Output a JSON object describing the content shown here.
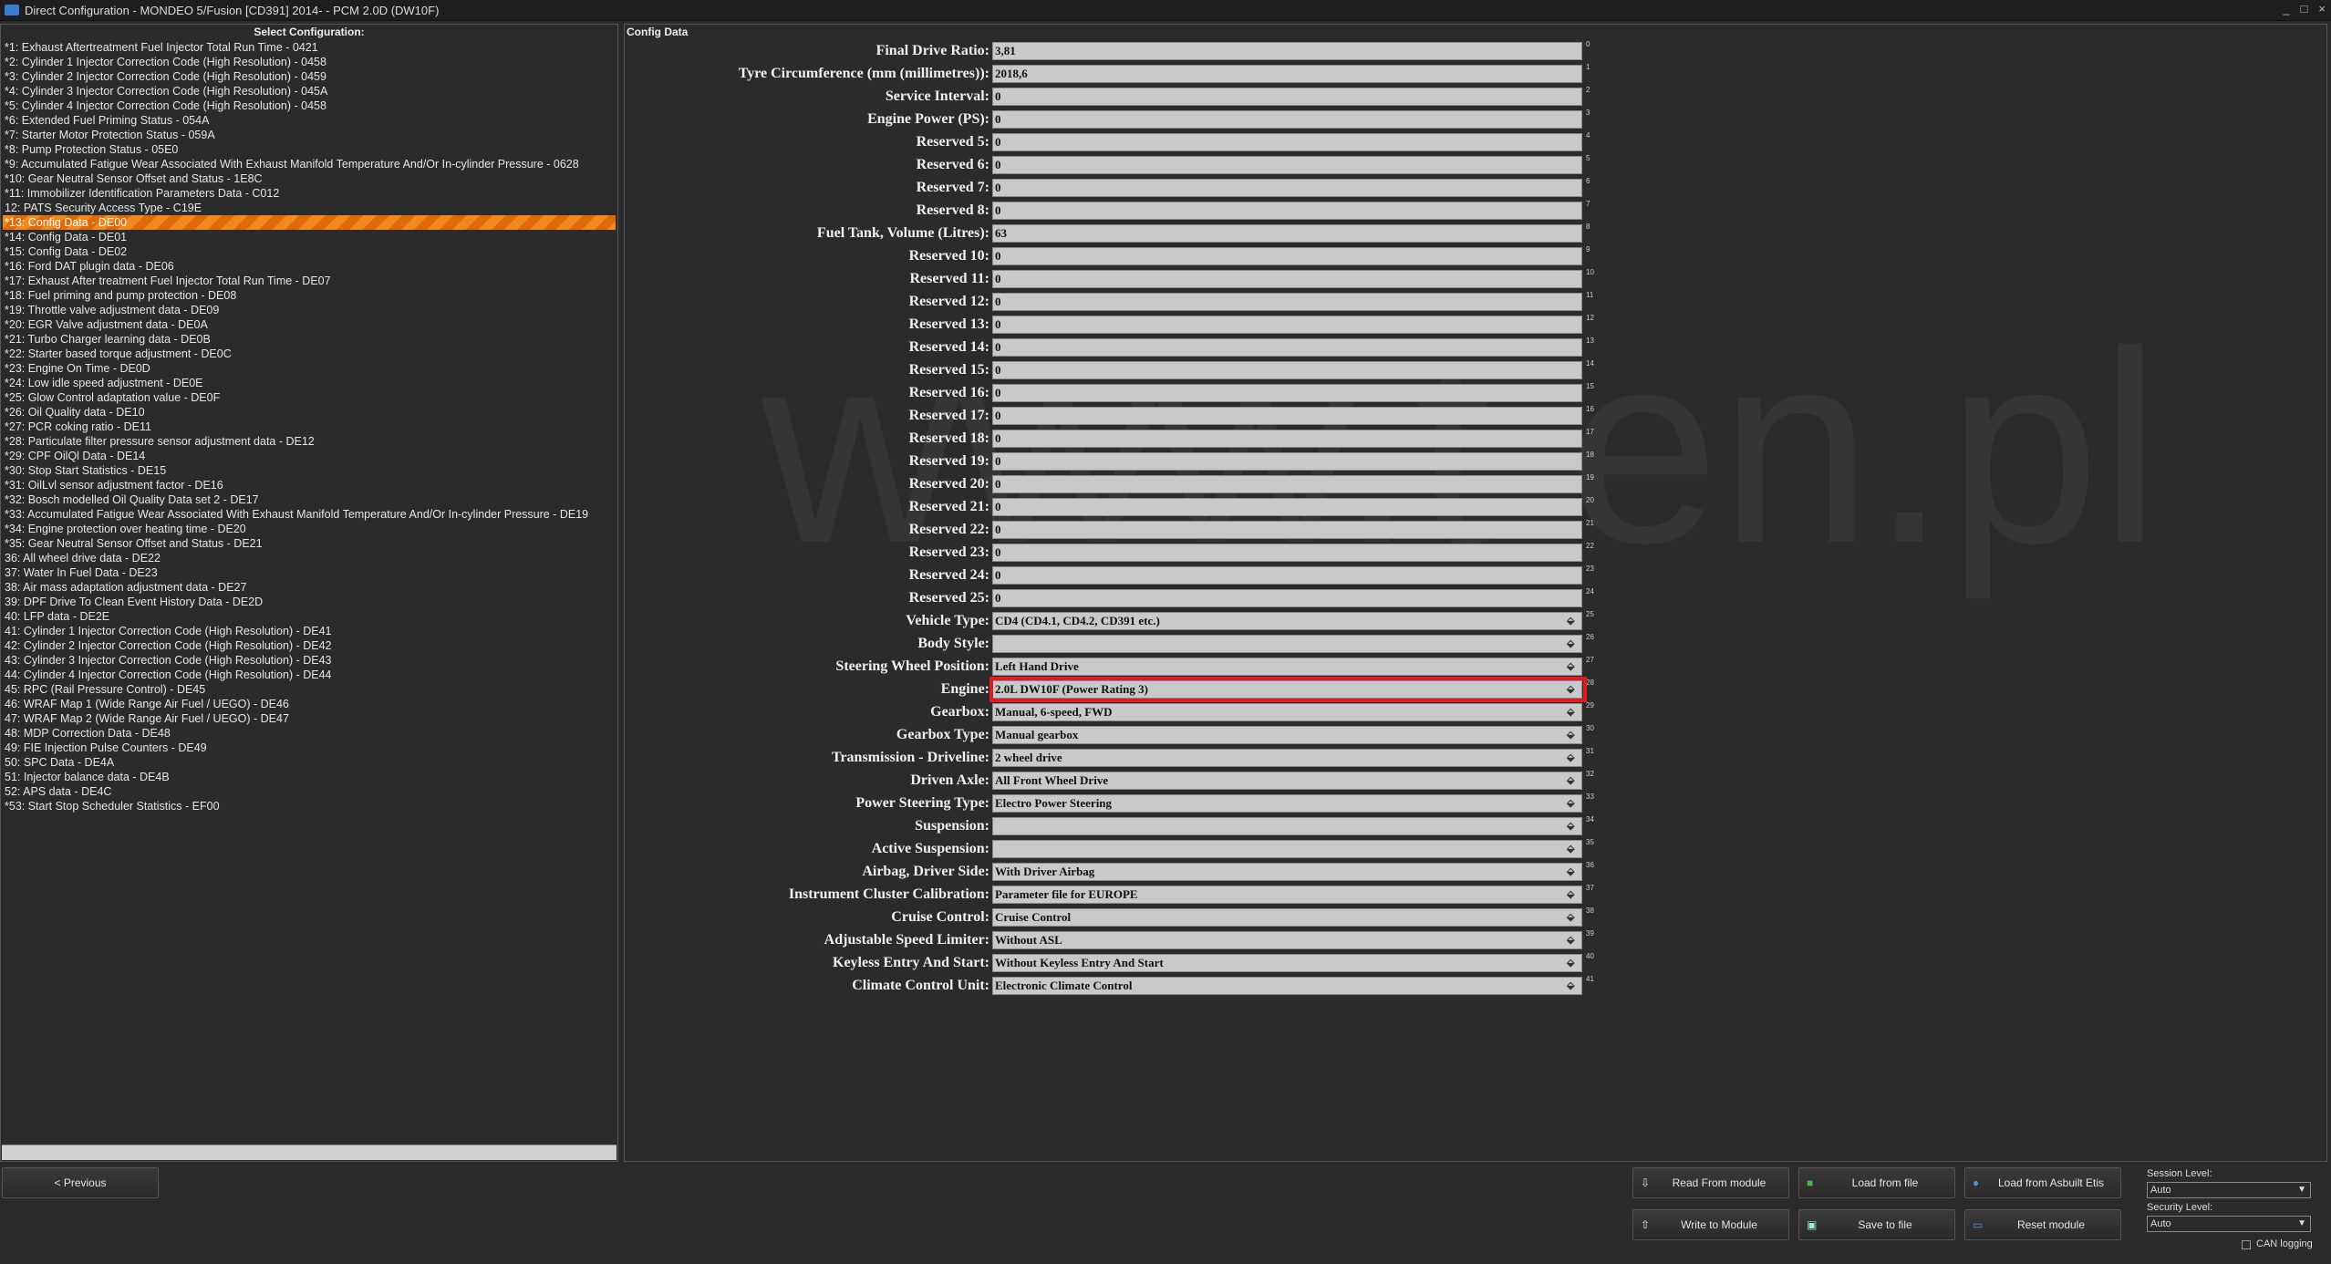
{
  "window": {
    "title": "Direct Configuration - MONDEO 5/Fusion [CD391] 2014- - PCM 2.0D (DW10F)",
    "controls": [
      "_",
      "□",
      "×"
    ]
  },
  "left_panel": {
    "header": "Select Configuration:",
    "items": [
      "*1: Exhaust Aftertreatment Fuel Injector Total Run Time - 0421",
      "*2: Cylinder 1  Injector Correction Code (High Resolution) - 0458",
      "*3: Cylinder 2  Injector Correction Code (High Resolution) - 0459",
      "*4: Cylinder 3  Injector Correction Code (High Resolution) - 045A",
      "*5: Cylinder 4  Injector Correction Code (High Resolution) - 0458",
      "*6: Extended Fuel Priming Status - 054A",
      "*7: Starter Motor Protection Status - 059A",
      "*8: Pump Protection Status - 05E0",
      "*9: Accumulated Fatigue Wear Associated With Exhaust Manifold Temperature And/Or In-cylinder Pressure - 0628",
      "*10: Gear Neutral Sensor Offset and Status - 1E8C",
      "*11: Immobilizer Identification Parameters Data - C012",
      "12: PATS Security Access Type - C19E",
      "*13: Config Data - DE00",
      "*14: Config Data - DE01",
      "*15: Config Data - DE02",
      "*16: Ford DAT plugin data - DE06",
      "*17: Exhaust After treatment Fuel Injector Total Run Time - DE07",
      "*18: Fuel priming and pump protection - DE08",
      "*19: Throttle valve adjustment data - DE09",
      "*20: EGR Valve adjustment  data - DE0A",
      "*21: Turbo Charger learning data - DE0B",
      "*22: Starter based torque adjustment - DE0C",
      "*23: Engine On Time - DE0D",
      "*24: Low idle speed adjustment - DE0E",
      "*25: Glow Control adaptation value - DE0F",
      "*26: Oil Quality  data - DE10",
      "*27: PCR coking ratio - DE11",
      "*28: Particulate filter pressure sensor adjustment data - DE12",
      "*29: CPF OilQl Data - DE14",
      "*30: Stop Start Statistics - DE15",
      "*31: OilLvl sensor adjustment factor - DE16",
      "*32: Bosch modelled Oil Quality Data set 2 - DE17",
      "*33: Accumulated Fatigue Wear Associated With Exhaust Manifold Temperature And/Or In-cylinder Pressure - DE19",
      "*34: Engine protection over heating time - DE20",
      "*35: Gear Neutral Sensor Offset and Status - DE21",
      "36: All wheel drive data - DE22",
      "37: Water In Fuel Data - DE23",
      "38: Air mass adaptation adjustment data - DE27",
      "39: DPF Drive To Clean Event History Data - DE2D",
      "40: LFP data - DE2E",
      "41: Cylinder 1  Injector Correction Code (High Resolution) - DE41",
      "42: Cylinder 2  Injector Correction Code (High Resolution) - DE42",
      "43: Cylinder 3  Injector Correction Code (High Resolution) - DE43",
      "44: Cylinder 4  Injector Correction Code (High Resolution) - DE44",
      "45: RPC (Rail Pressure Control) - DE45",
      "46: WRAF Map 1 (Wide Range Air Fuel / UEGO) - DE46",
      "47: WRAF Map 2 (Wide Range Air Fuel / UEGO) - DE47",
      "48: MDP Correction Data - DE48",
      "49: FIE Injection Pulse Counters - DE49",
      "50: SPC Data - DE4A",
      "51: Injector balance data - DE4B",
      "52: APS data - DE4C",
      "*53: Start Stop Scheduler Statistics - EF00"
    ],
    "selected_index": 12
  },
  "right_panel": {
    "header": "Config Data",
    "watermark": "www.t            en.pl",
    "fields": [
      {
        "label": "Final Drive Ratio:",
        "value": "3,81",
        "index": "0",
        "dropdown": false
      },
      {
        "label": "Tyre Circumference (mm (millimetres)):",
        "value": "2018,6",
        "index": "1",
        "dropdown": false
      },
      {
        "label": "Service Interval:",
        "value": "0",
        "index": "2",
        "dropdown": false
      },
      {
        "label": "Engine Power (PS):",
        "value": "0",
        "index": "3",
        "dropdown": false
      },
      {
        "label": "Reserved 5:",
        "value": "0",
        "index": "4",
        "dropdown": false
      },
      {
        "label": "Reserved 6:",
        "value": "0",
        "index": "5",
        "dropdown": false
      },
      {
        "label": "Reserved 7:",
        "value": "0",
        "index": "6",
        "dropdown": false
      },
      {
        "label": "Reserved 8:",
        "value": "0",
        "index": "7",
        "dropdown": false
      },
      {
        "label": "Fuel Tank, Volume (Litres):",
        "value": "63",
        "index": "8",
        "dropdown": false
      },
      {
        "label": "Reserved 10:",
        "value": "0",
        "index": "9",
        "dropdown": false
      },
      {
        "label": "Reserved 11:",
        "value": "0",
        "index": "10",
        "dropdown": false
      },
      {
        "label": "Reserved 12:",
        "value": "0",
        "index": "11",
        "dropdown": false
      },
      {
        "label": "Reserved 13:",
        "value": "0",
        "index": "12",
        "dropdown": false
      },
      {
        "label": "Reserved 14:",
        "value": "0",
        "index": "13",
        "dropdown": false
      },
      {
        "label": "Reserved 15:",
        "value": "0",
        "index": "14",
        "dropdown": false
      },
      {
        "label": "Reserved 16:",
        "value": "0",
        "index": "15",
        "dropdown": false
      },
      {
        "label": "Reserved 17:",
        "value": "0",
        "index": "16",
        "dropdown": false
      },
      {
        "label": "Reserved 18:",
        "value": "0",
        "index": "17",
        "dropdown": false
      },
      {
        "label": "Reserved 19:",
        "value": "0",
        "index": "18",
        "dropdown": false
      },
      {
        "label": "Reserved 20:",
        "value": "0",
        "index": "19",
        "dropdown": false
      },
      {
        "label": "Reserved 21:",
        "value": "0",
        "index": "20",
        "dropdown": false
      },
      {
        "label": "Reserved 22:",
        "value": "0",
        "index": "21",
        "dropdown": false
      },
      {
        "label": "Reserved 23:",
        "value": "0",
        "index": "22",
        "dropdown": false
      },
      {
        "label": "Reserved 24:",
        "value": "0",
        "index": "23",
        "dropdown": false
      },
      {
        "label": "Reserved 25:",
        "value": "0",
        "index": "24",
        "dropdown": false
      },
      {
        "label": "Vehicle Type:",
        "value": "CD4 (CD4.1, CD4.2, CD391 etc.)",
        "index": "25",
        "dropdown": true
      },
      {
        "label": "Body Style:",
        "value": "",
        "index": "26",
        "dropdown": true
      },
      {
        "label": "Steering Wheel Position:",
        "value": "Left Hand Drive",
        "index": "27",
        "dropdown": true
      },
      {
        "label": "Engine:",
        "value": "2.0L DW10F (Power Rating 3)",
        "index": "28",
        "dropdown": true
      },
      {
        "label": "Gearbox:",
        "value": "Manual, 6-speed, FWD",
        "index": "29",
        "dropdown": true
      },
      {
        "label": "Gearbox Type:",
        "value": "Manual gearbox",
        "index": "30",
        "dropdown": true
      },
      {
        "label": "Transmission  - Driveline:",
        "value": "2 wheel drive",
        "index": "31",
        "dropdown": true
      },
      {
        "label": "Driven Axle:",
        "value": "All Front Wheel Drive",
        "index": "32",
        "dropdown": true
      },
      {
        "label": "Power Steering Type:",
        "value": "Electro Power Steering",
        "index": "33",
        "dropdown": true
      },
      {
        "label": "Suspension:",
        "value": "",
        "index": "34",
        "dropdown": true
      },
      {
        "label": "Active Suspension:",
        "value": "",
        "index": "35",
        "dropdown": true
      },
      {
        "label": "Airbag, Driver Side:",
        "value": "With Driver Airbag",
        "index": "36",
        "dropdown": true
      },
      {
        "label": "Instrument Cluster Calibration:",
        "value": "Parameter file for EUROPE",
        "index": "37",
        "dropdown": true
      },
      {
        "label": "Cruise Control:",
        "value": "Cruise Control",
        "index": "38",
        "dropdown": true
      },
      {
        "label": "Adjustable Speed Limiter:",
        "value": "Without ASL",
        "index": "39",
        "dropdown": true
      },
      {
        "label": "Keyless Entry And Start:",
        "value": "Without Keyless Entry And Start",
        "index": "40",
        "dropdown": true
      },
      {
        "label": "Climate Control Unit:",
        "value": "Electronic Climate Control",
        "index": "41",
        "dropdown": true
      }
    ],
    "highlighted_field": 28,
    "highlight_color": "#e01b24"
  },
  "bottom": {
    "previous_label": "< Previous",
    "buttons": {
      "read_from_module": "Read From module",
      "load_from_file": "Load from file",
      "load_from_asbuilt": "Load from Asbuilt Etis",
      "write_to_module": "Write to Module",
      "save_to_file": "Save to file",
      "reset_module": "Reset module"
    },
    "session_level_label": "Session Level:",
    "session_level_value": "Auto",
    "security_level_label": "Security Level:",
    "security_level_value": "Auto",
    "can_logging_label": "CAN logging"
  },
  "colors": {
    "selected_row": "#f08a1c",
    "field_background": "#c9c9c9",
    "panel_background": "#2b2b2b"
  }
}
